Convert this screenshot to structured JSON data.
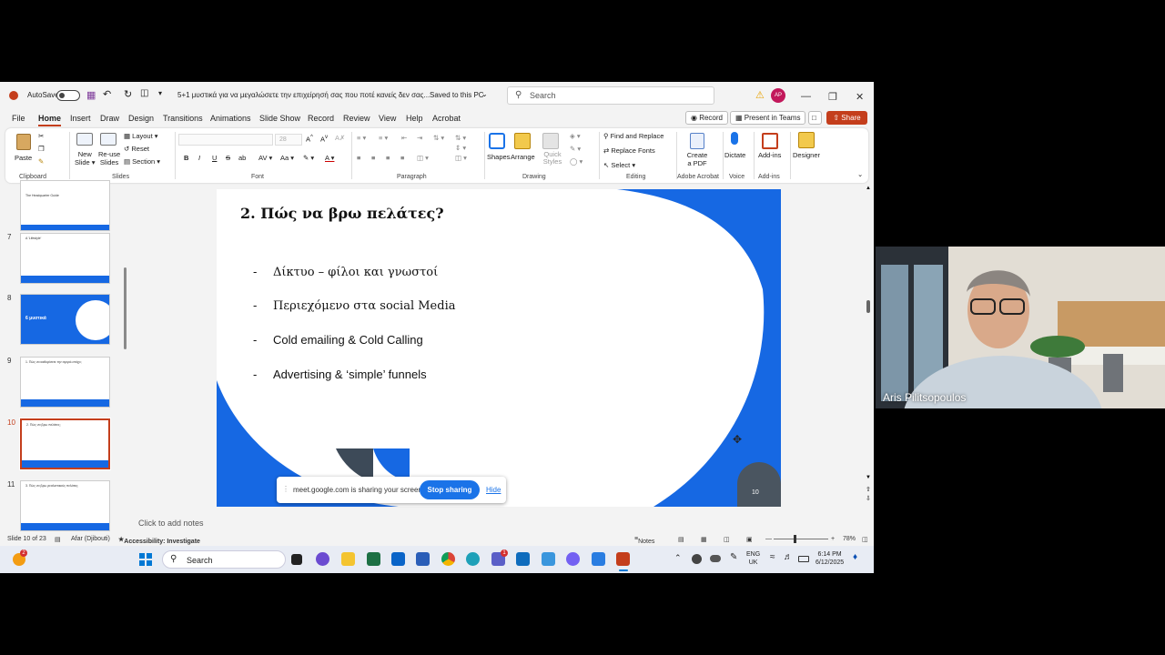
{
  "window": {
    "autosave_label": "AutoSave",
    "doc_title": "5+1 μυστικά για να μεγαλώσετε την επιχείρησή σας που ποτέ κανείς δεν σας...",
    "saved_status": "Saved to this PC",
    "search_placeholder": "Search",
    "avatar_initials": "AP"
  },
  "tabs": [
    "File",
    "Home",
    "Insert",
    "Draw",
    "Design",
    "Transitions",
    "Animations",
    "Slide Show",
    "Record",
    "Review",
    "View",
    "Help",
    "Acrobat"
  ],
  "toolbar": {
    "record": "Record",
    "present": "Present in Teams",
    "share": "Share"
  },
  "ribbon": {
    "paste": "Paste",
    "new_slide": "New Slide",
    "reuse_slides": "Re-use Slides",
    "layout": "Layout",
    "reset": "Reset",
    "section": "Section",
    "font_size": "28",
    "shapes": "Shapes",
    "arrange": "Arrange",
    "quick_styles": "Quick Styles",
    "find_replace": "Find and Replace",
    "replace_fonts": "Replace Fonts",
    "select": "Select",
    "create_pdf": "Create a PDF",
    "dictate": "Dictate",
    "addins": "Add-ins",
    "designer": "Designer",
    "groups": {
      "clipboard": "Clipboard",
      "slides": "Slides",
      "font": "Font",
      "paragraph": "Paragraph",
      "drawing": "Drawing",
      "editing": "Editing",
      "adobe": "Adobe Acrobat",
      "voice": "Voice",
      "addins": "Add-ins"
    }
  },
  "thumbnails": [
    {
      "num": "",
      "text": "The Headquarter Guide"
    },
    {
      "num": "7",
      "text": "A 'Lifestyle'"
    },
    {
      "num": "8",
      "text": "6 μυστικά"
    },
    {
      "num": "9",
      "text": "1. Πώς να καθορίσετε την αγορά-στόχο;"
    },
    {
      "num": "10",
      "text": "2. Πώς να βρω πελάτες;"
    },
    {
      "num": "11",
      "text": "3. Πώς να βρω ρεαλιστικούς πελάτες;"
    }
  ],
  "slide": {
    "title": "2. Πώς να βρω πελάτες?",
    "bullets": [
      "Δίκτυο – φίλοι και γνωστοί",
      "Περιεχόμενο στα social Media",
      "Cold emailing & Cold Calling",
      "Advertising & ‘simple’ funnels"
    ],
    "page_number": "10",
    "accent_color": "#1668e3"
  },
  "sharebar": {
    "message": "meet.google.com is sharing your screen.",
    "stop": "Stop sharing",
    "hide": "Hide"
  },
  "notes_placeholder": "Click to add notes",
  "status": {
    "slide_counter": "Slide 10 of 23",
    "language": "Afar (Djibouti)",
    "accessibility": "Accessibility: Investigate",
    "notes": "Notes",
    "zoom": "78%"
  },
  "taskbar": {
    "search": "Search",
    "lang": "ENG",
    "region": "UK",
    "time": "6:14 PM",
    "date": "6/12/2025",
    "weather_badge": "2",
    "teams_badge": "1"
  },
  "webcam": {
    "participant_name": "Aris Pilitsopoulos"
  }
}
